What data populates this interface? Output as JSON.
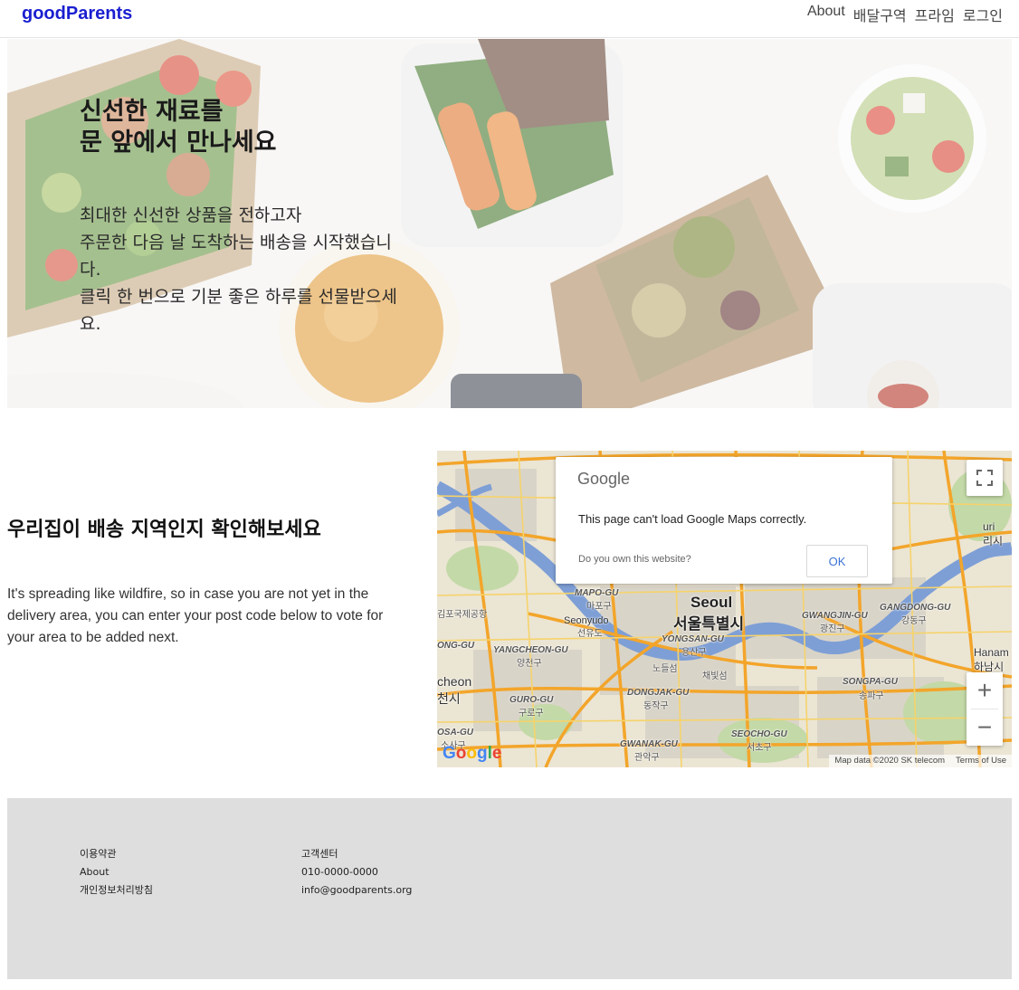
{
  "nav": {
    "brand": "goodParents",
    "items": [
      {
        "label": "About"
      },
      {
        "label": "배달구역"
      },
      {
        "label": "프라임"
      },
      {
        "label": "로그인"
      }
    ]
  },
  "hero": {
    "title_lines": [
      "신선한 재료를",
      "문 앞에서 만나세요"
    ],
    "text_lines": [
      "최대한 신선한 상품을 전하고자",
      "주문한 다음 날 도착하는 배송을 시작했습니",
      "다.",
      "클릭 한 번으로 기분 좋은 하루를 선물받으세",
      "요."
    ]
  },
  "delivery": {
    "title": "우리집이 배송 지역인지 확인해보세요",
    "text": "It's spreading like wildfire, so in case you are not yet in the delivery area, you can enter your post code below to vote for your area to be added next."
  },
  "map": {
    "error": {
      "logo": "Google",
      "message": "This page can't load Google Maps correctly.",
      "question": "Do you own this website?",
      "ok_label": "OK"
    },
    "labels": {
      "seoul_en": "Seoul",
      "seoul_ko": "서울특별시",
      "mapo_en": "MAPO-GU",
      "mapo_ko": "마포구",
      "seonyudo_en": "Seonyudo",
      "seonyudo_ko": "선유도",
      "gimpo": "김포국제공항",
      "yangcheon_en": "YANGCHEON-GU",
      "yangcheon_ko": "양천구",
      "yongsan_en": "YONGSAN-GU",
      "yongsan_ko": "용산구",
      "nodeulseom": "노들섬",
      "chaebitseom": "채빛섬",
      "gangwon_en": "GWANGJIN-GU",
      "gangwon_ko": "광진구",
      "gangdong_en": "GANGDONG-GU",
      "gangdong_ko": "강동구",
      "dongjak_en": "DONGJAK-GU",
      "dongjak_ko": "동작구",
      "guro_en": "GURO-GU",
      "guro_ko": "구로구",
      "songpa_en": "SONGPA-GU",
      "songpa_ko": "송파구",
      "seocho_en": "SEOCHO-GU",
      "seocho_ko": "서초구",
      "gwanak_en": "GWANAK-GU",
      "gwanak_ko": "관악구",
      "ong_gu": "ONG-GU",
      "cheon_en": "cheon",
      "cheon_ko": "천시",
      "osa_en": "OSA-GU",
      "osa_ko": "소사구",
      "guri_en": "uri",
      "guri_ko": "리시",
      "hanam_en": "Hanam",
      "hanam_ko": "하남시"
    },
    "google_logo": "Google",
    "attribution": "Map data ©2020 SK telecom",
    "terms": "Terms of Use",
    "zoom_in": "+",
    "zoom_out": "−"
  },
  "footer": {
    "col1": [
      "이용약관",
      "About",
      "개인정보처리방침"
    ],
    "col2": [
      "고객센터",
      "010-0000-0000",
      "info@goodparents.org"
    ]
  },
  "colors": {
    "brand": "#1a1fd0",
    "footer_bg": "#dedede",
    "map_road": "#f3a52a",
    "map_water": "#7e9fd6",
    "ok_blue": "#3b73d6"
  }
}
